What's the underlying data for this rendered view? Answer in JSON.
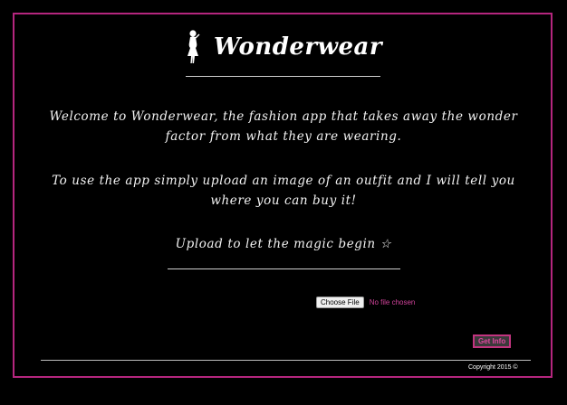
{
  "brand": {
    "name": "Wonderwear",
    "logo_icon": "woman-silhouette-icon"
  },
  "intro": {
    "paragraph1": "Welcome to Wonderwear, the fashion app that takes away the wonder factor from what they are wearing.",
    "paragraph2": "To use the app simply upload an image of an outfit and I will tell you where you can buy it!",
    "paragraph3": "Upload to let the magic begin ☆"
  },
  "upload": {
    "button_label": "Choose File",
    "status": "No file chosen"
  },
  "actions": {
    "get_info_label": "Get Info"
  },
  "footer": {
    "copyright": "Copyright 2015 ©"
  },
  "colors": {
    "background": "#000000",
    "accent": "#b5267e",
    "text": "#ffffff"
  }
}
